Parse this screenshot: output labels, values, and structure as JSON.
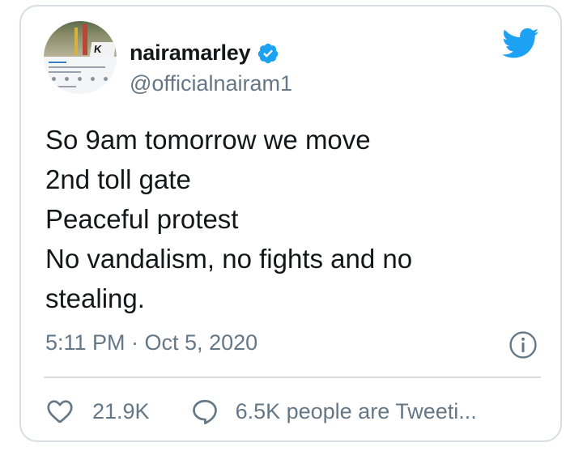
{
  "tweet": {
    "display_name": "nairamarley",
    "handle": "@officialnairam1",
    "text_lines": [
      "So 9am tomorrow we move",
      "2nd toll gate",
      "Peaceful protest",
      "No vandalism, no fights and no",
      "stealing."
    ],
    "timestamp": "5:11 PM · Oct 5, 2020",
    "likes_count": "21.9K",
    "reply_text": "6.5K people are Tweeti..."
  },
  "icons": {
    "verified": "verified-badge-icon",
    "brand": "twitter-bird-icon",
    "info": "info-icon",
    "like": "heart-icon",
    "reply": "speech-bubble-icon"
  },
  "colors": {
    "brand_blue": "#1da1f2",
    "text": "#14171a",
    "secondary": "#657786",
    "border": "#d9dde1"
  }
}
